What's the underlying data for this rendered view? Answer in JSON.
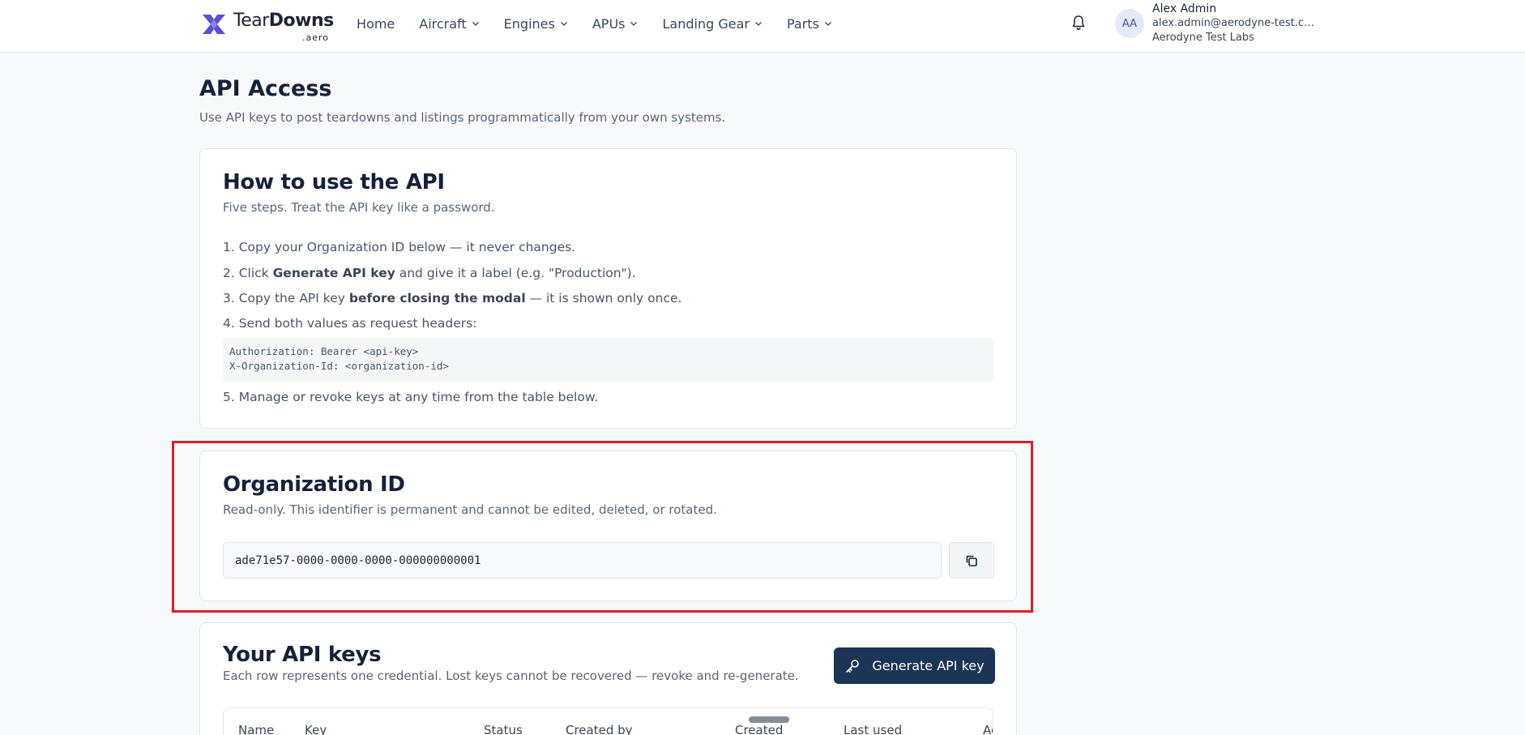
{
  "header": {
    "logo": {
      "word_thin": "Tear",
      "word_bold": "Downs",
      "suffix": ".aero"
    },
    "nav": [
      {
        "label": "Home",
        "has_menu": false
      },
      {
        "label": "Aircraft",
        "has_menu": true
      },
      {
        "label": "Engines",
        "has_menu": true
      },
      {
        "label": "APUs",
        "has_menu": true
      },
      {
        "label": "Landing Gear",
        "has_menu": true
      },
      {
        "label": "Parts",
        "has_menu": true
      }
    ],
    "user": {
      "initials": "AA",
      "name": "Alex Admin",
      "email": "alex.admin@aerodyne-test.co...",
      "org": "Aerodyne Test Labs"
    }
  },
  "page": {
    "title": "API Access",
    "subtitle": "Use API keys to post teardowns and listings programmatically from your own systems."
  },
  "howto": {
    "title": "How to use the API",
    "subtitle": "Five steps. Treat the API key like a password.",
    "step1": "1. Copy your Organization ID below — it never changes.",
    "step2": {
      "pre": "2. Click ",
      "bold": "Generate API key",
      "post": " and give it a label (e.g. \"Production\")."
    },
    "step3": {
      "pre": "3. Copy the API key ",
      "bold": "before closing the modal",
      "post": " — it is shown only once."
    },
    "step4": "4. Send both values as request headers:",
    "code_line1": "Authorization: Bearer <api-key>",
    "code_line2": "X-Organization-Id: <organization-id>",
    "step5": "5. Manage or revoke keys at any time from the table below."
  },
  "org": {
    "title": "Organization ID",
    "subtitle": "Read-only. This identifier is permanent and cannot be edited, deleted, or rotated.",
    "value": "ade71e57-0000-0000-0000-000000000001",
    "copy_icon": "copy-icon"
  },
  "keys": {
    "title": "Your API keys",
    "subtitle": "Each row represents one credential. Lost keys cannot be recovered — revoke and re-generate.",
    "generate_label": "Generate API key",
    "columns": [
      "Name",
      "Key",
      "Status",
      "Created by",
      "Created",
      "Last used",
      "Ac"
    ]
  },
  "colors": {
    "primary": "#1c3557",
    "accent": "#5b4fd6",
    "highlight": "#d62027"
  }
}
